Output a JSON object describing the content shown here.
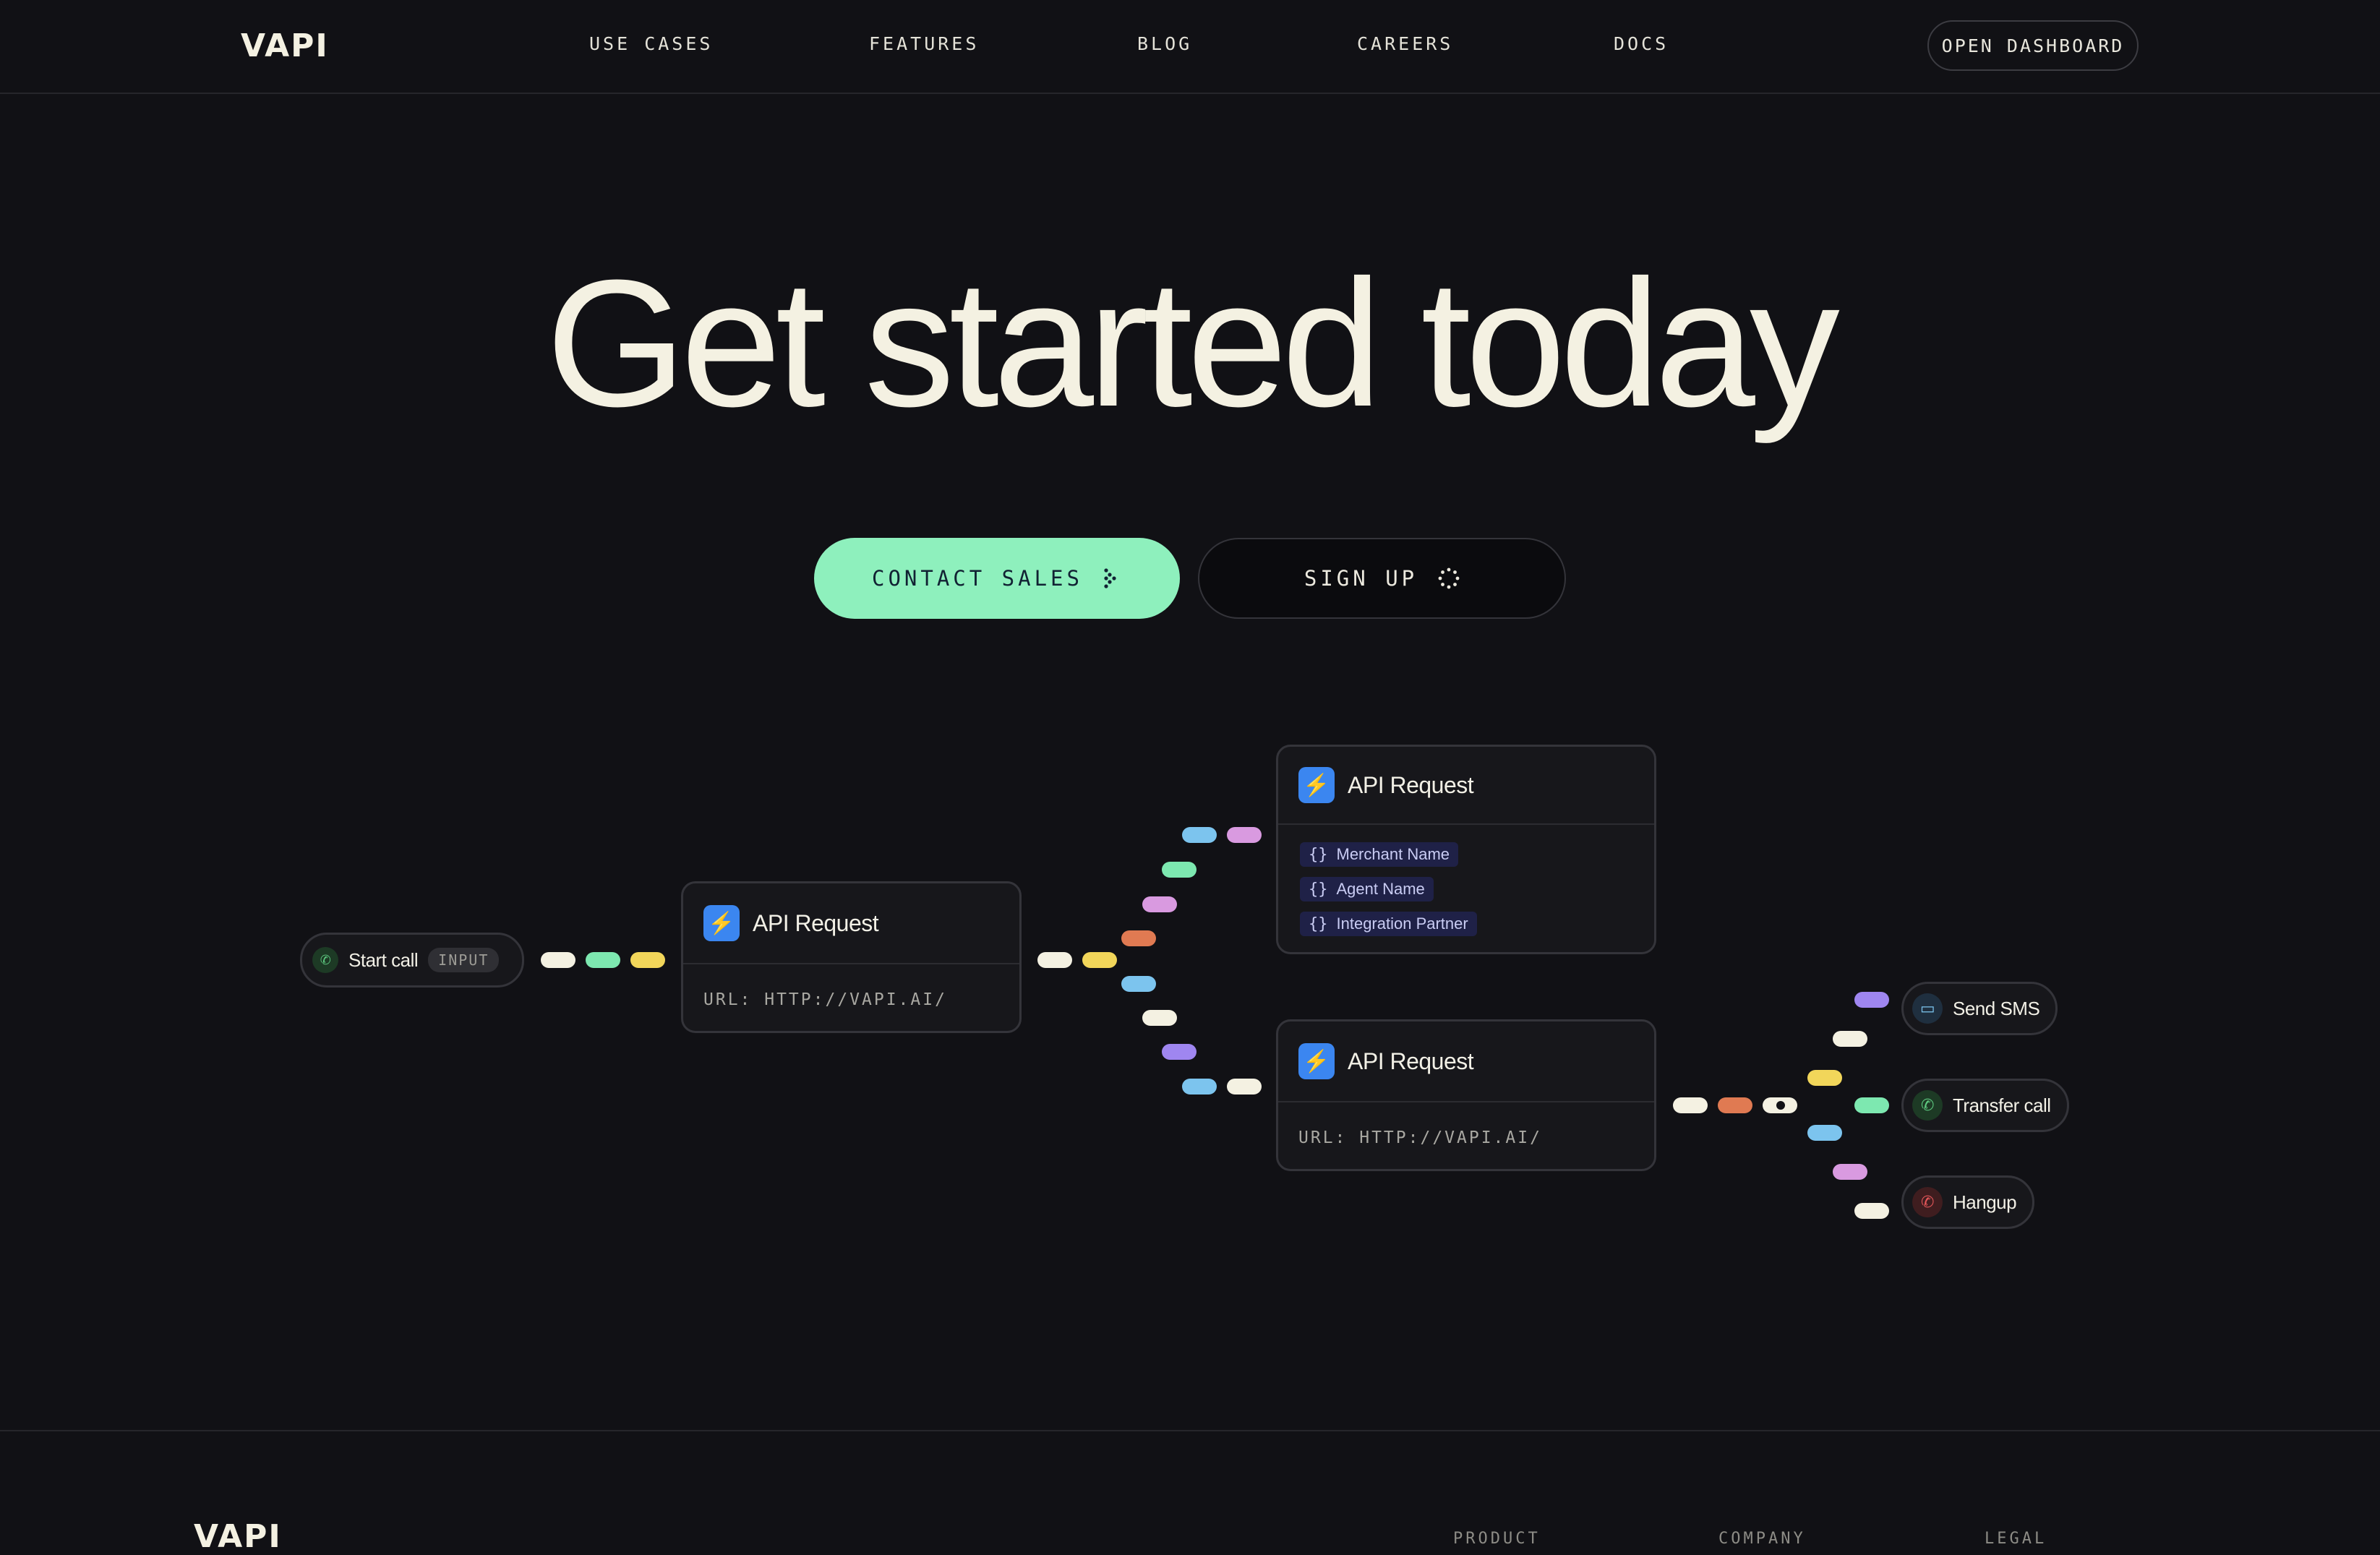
{
  "nav": {
    "logo": "VAPI",
    "links": [
      "USE CASES",
      "FEATURES",
      "BLOG",
      "CAREERS",
      "DOCS"
    ],
    "dashboard_button": "OPEN DASHBOARD"
  },
  "hero": {
    "title": "Get started today",
    "primary_button": "CONTACT SALES",
    "secondary_button": "SIGN UP"
  },
  "flow": {
    "start_node": {
      "label": "Start call",
      "badge": "INPUT"
    },
    "api_node_1": {
      "title": "API Request",
      "url": "URL: HTTP://VAPI.AI/"
    },
    "api_node_2": {
      "title": "API Request",
      "variables": [
        "Merchant Name",
        "Agent Name",
        "Integration Partner"
      ],
      "variable_glyph": "{}"
    },
    "api_node_3": {
      "title": "API Request",
      "url": "URL: HTTP://VAPI.AI/"
    },
    "end_nodes": [
      {
        "label": "Send SMS",
        "icon": "message-icon"
      },
      {
        "label": "Transfer call",
        "icon": "phone-icon"
      },
      {
        "label": "Hangup",
        "icon": "hangup-icon"
      }
    ],
    "colors": {
      "white": "#f4f1e2",
      "green": "#7de8b0",
      "yellow": "#f2d65a",
      "orange": "#e07a52",
      "blue": "#7cc4ee",
      "pink": "#d99ae0",
      "purple": "#9f86f0",
      "api_icon": "#3b86f0"
    }
  },
  "footer": {
    "logo": "VAPI",
    "columns": [
      "PRODUCT",
      "COMPANY",
      "LEGAL"
    ]
  }
}
